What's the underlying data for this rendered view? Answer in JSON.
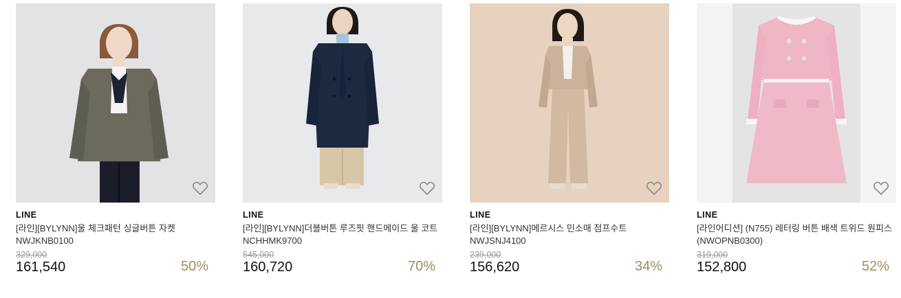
{
  "products": [
    {
      "brand": "LINE",
      "title": "[라인][BYLYNN]울 체크패턴 싱글버튼 자켓 NWJKNB0100",
      "original_price": "329,000",
      "sale_price": "161,540",
      "discount": "50%"
    },
    {
      "brand": "LINE",
      "title": "[라인][BYLYNN]더블버튼 루즈핏 핸드메이드 울 코트 NCHHMK9700",
      "original_price": "545,000",
      "sale_price": "160,720",
      "discount": "70%"
    },
    {
      "brand": "LINE",
      "title": "[라인][BYLYNN]메르시스 민소매 점프수트 NWJSNJ4100",
      "original_price": "239,000",
      "sale_price": "156,620",
      "discount": "34%"
    },
    {
      "brand": "LINE",
      "title": "[라인어디션] (N755) 레터링 버튼 배색 트위드 원피스 (NWOPNB0300)",
      "original_price": "319,000",
      "sale_price": "152,800",
      "discount": "52%"
    }
  ],
  "icons": {
    "wishlist": "heart-outline-icon"
  },
  "colors": {
    "discount": "#a08c5b",
    "original_price": "#9a9a9a"
  }
}
